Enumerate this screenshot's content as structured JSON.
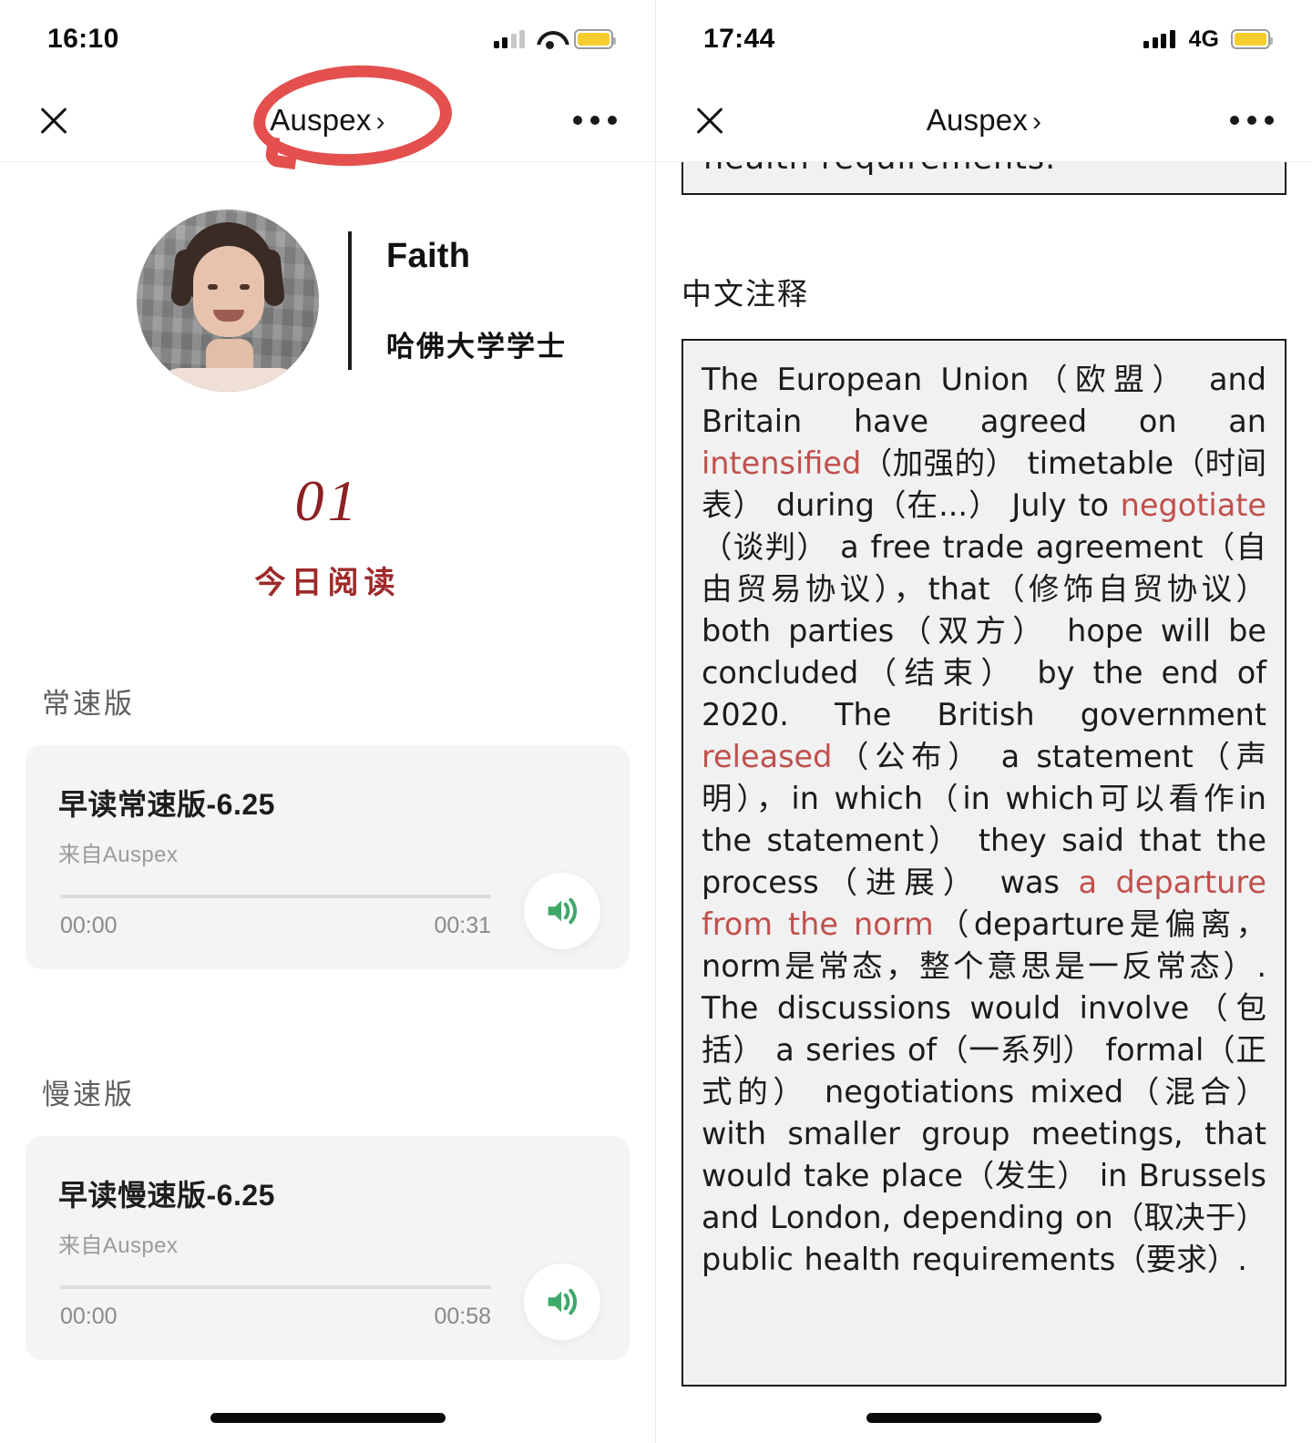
{
  "left": {
    "status": {
      "time": "16:10",
      "signal_bars_filled": 2,
      "wifi": "wifi-icon",
      "battery": "battery-icon"
    },
    "nav": {
      "title": "Auspex",
      "chevron": "›",
      "close": "close-icon",
      "more": "more-options-icon"
    },
    "annotation": {
      "color": "#e4504e",
      "shape": "hand-drawn-circle"
    },
    "profile": {
      "name": "Faith",
      "credential": "哈佛大学学士"
    },
    "read": {
      "number": "01",
      "label": "今日阅读"
    },
    "sections": [
      {
        "heading": "常速版",
        "card": {
          "title": "早读常速版-6.25",
          "from": "来自Auspex",
          "current_time": "00:00",
          "total_time": "00:31",
          "play_icon": "sound-wave-icon",
          "accent": "#3ea968"
        }
      },
      {
        "heading": "慢速版",
        "card": {
          "title": "早读慢速版-6.25",
          "from": "来自Auspex",
          "current_time": "00:00",
          "total_time": "00:58",
          "play_icon": "sound-wave-icon",
          "accent": "#3ea968"
        }
      }
    ]
  },
  "right": {
    "status": {
      "time": "17:44",
      "network": "4G",
      "signal_bars_filled": 4,
      "battery": "battery-icon"
    },
    "nav": {
      "title": "Auspex",
      "chevron": "›",
      "close": "close-icon",
      "more": "more-options-icon"
    },
    "clipped_text": "health requirements.",
    "heading": "中文注释",
    "annotation_body": {
      "segments": [
        {
          "t": "The European Union（欧盟） and Britain have agreed on an ",
          "hl": false
        },
        {
          "t": "intensified",
          "hl": true
        },
        {
          "t": "（加强的） timetable（时间表） during（在...） July to ",
          "hl": false
        },
        {
          "t": "negotiate",
          "hl": true
        },
        {
          "t": "（谈判） a free trade agreement（自由贸易协议），that（修饰自贸协议） both parties（双方） hope will be concluded（结束） by the end of 2020. The British government ",
          "hl": false
        },
        {
          "t": "released",
          "hl": true
        },
        {
          "t": "（公布） a statement（声明），in which（in which可以看作in the statement） they said that the process（进展） was ",
          "hl": false
        },
        {
          "t": "a departure from the norm",
          "hl": true
        },
        {
          "t": "（departure是偏离，norm是常态，整个意思是一反常态）. The discussions would involve（包括） a series of（一系列） formal（正式的） negotiations mixed（混合） with smaller group meetings, that would take place（发生） in Brussels and London, depending on（取决于） public health requirements（要求）.",
          "hl": false
        }
      ]
    }
  }
}
